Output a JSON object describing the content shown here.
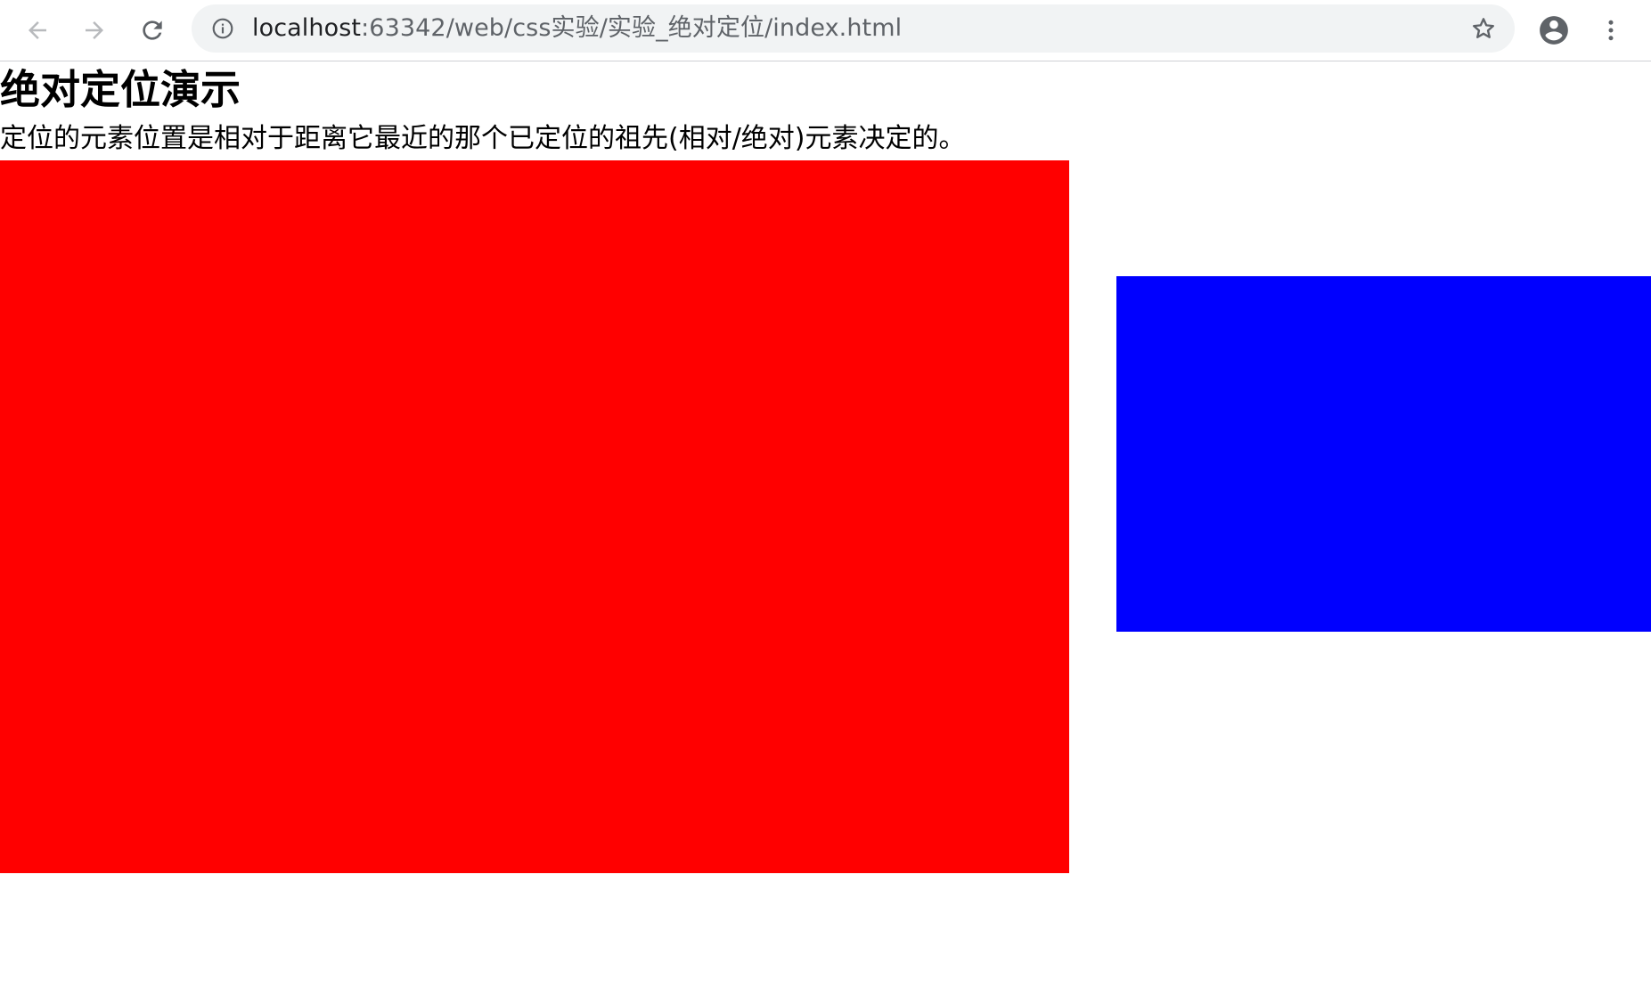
{
  "browser": {
    "url_host": "localhost",
    "url_rest": ":63342/web/css实验/实验_绝对定位/index.html",
    "icons": {
      "back": "arrow-left-icon",
      "forward": "arrow-right-icon",
      "reload": "reload-icon",
      "site_info": "info-circle-icon",
      "bookmark": "star-icon",
      "profile": "account-circle-icon",
      "menu": "vertical-dots-icon"
    }
  },
  "page": {
    "title": "绝对定位演示",
    "description": "定位的元素位置是相对于距离它最近的那个已定位的祖先(相对/绝对)元素决定的。"
  },
  "colors": {
    "red_box": "#ff0000",
    "blue_box": "#0000ff"
  }
}
